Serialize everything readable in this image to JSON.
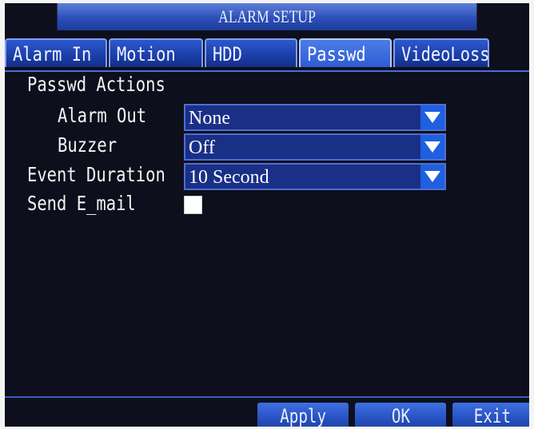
{
  "title": "ALARM SETUP",
  "tabs": [
    {
      "label": "Alarm In"
    },
    {
      "label": "Motion"
    },
    {
      "label": "HDD"
    },
    {
      "label": "Passwd"
    },
    {
      "label": "VideoLoss"
    }
  ],
  "active_tab": "Passwd",
  "section_title": "Passwd Actions",
  "fields": {
    "alarm_out": {
      "label": "Alarm Out",
      "value": "None"
    },
    "buzzer": {
      "label": "Buzzer",
      "value": "Off"
    },
    "event_duration": {
      "label": "Event Duration",
      "value": "10 Second"
    },
    "send_email": {
      "label": "Send E_mail",
      "checked": false
    }
  },
  "buttons": {
    "apply": "Apply",
    "ok": "OK",
    "exit": "Exit"
  },
  "icons": {
    "dropdown_arrow": "chevron-down-icon"
  },
  "colors": {
    "screen_bg": "#0d0f1c",
    "accent": "#2e58cf",
    "field_bg": "#1a2f86"
  }
}
